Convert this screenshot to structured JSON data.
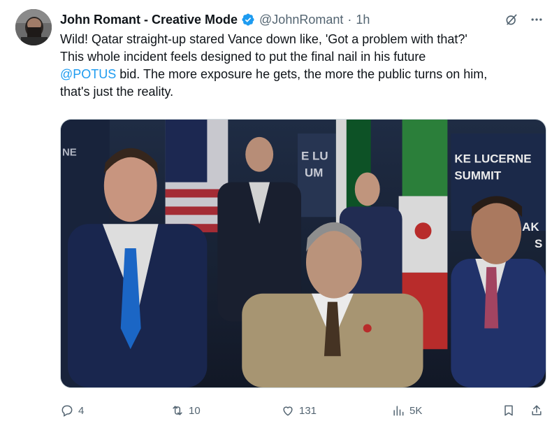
{
  "tweet": {
    "display_name": "John Romant - Creative Mode",
    "handle": "@JohnRomant",
    "separator": "·",
    "time": "1h",
    "text": {
      "line1": "Wild! Qatar straight-up stared Vance down like, 'Got a problem with that?'",
      "line2": "This whole incident feels designed to put the final nail in his future",
      "mention": "@POTUS",
      "line3_rest": " bid. The more exposure he gets, the more the public turns on him,",
      "line4": "that's just the reality."
    },
    "media": {
      "banner_text_1": "KE LUCERNE",
      "banner_text_2": "SUMMIT",
      "banner_text_left_1": "E LU",
      "banner_text_left_2": "UM",
      "banner_text_right_1": "AK",
      "banner_text_right_2": "S",
      "banner_text_far_left": "NE"
    },
    "stats": {
      "replies": "4",
      "reposts": "10",
      "likes": "131",
      "views": "5K"
    }
  },
  "icons": {
    "verified": "verified-badge-icon",
    "grok": "grok-icon",
    "more": "more-icon",
    "reply": "reply-icon",
    "repost": "repost-icon",
    "like": "like-icon",
    "views": "views-icon",
    "bookmark": "bookmark-icon",
    "share": "share-icon"
  },
  "colors": {
    "accent": "#1d9bf0",
    "text": "#0f1419",
    "secondary": "#536471"
  }
}
